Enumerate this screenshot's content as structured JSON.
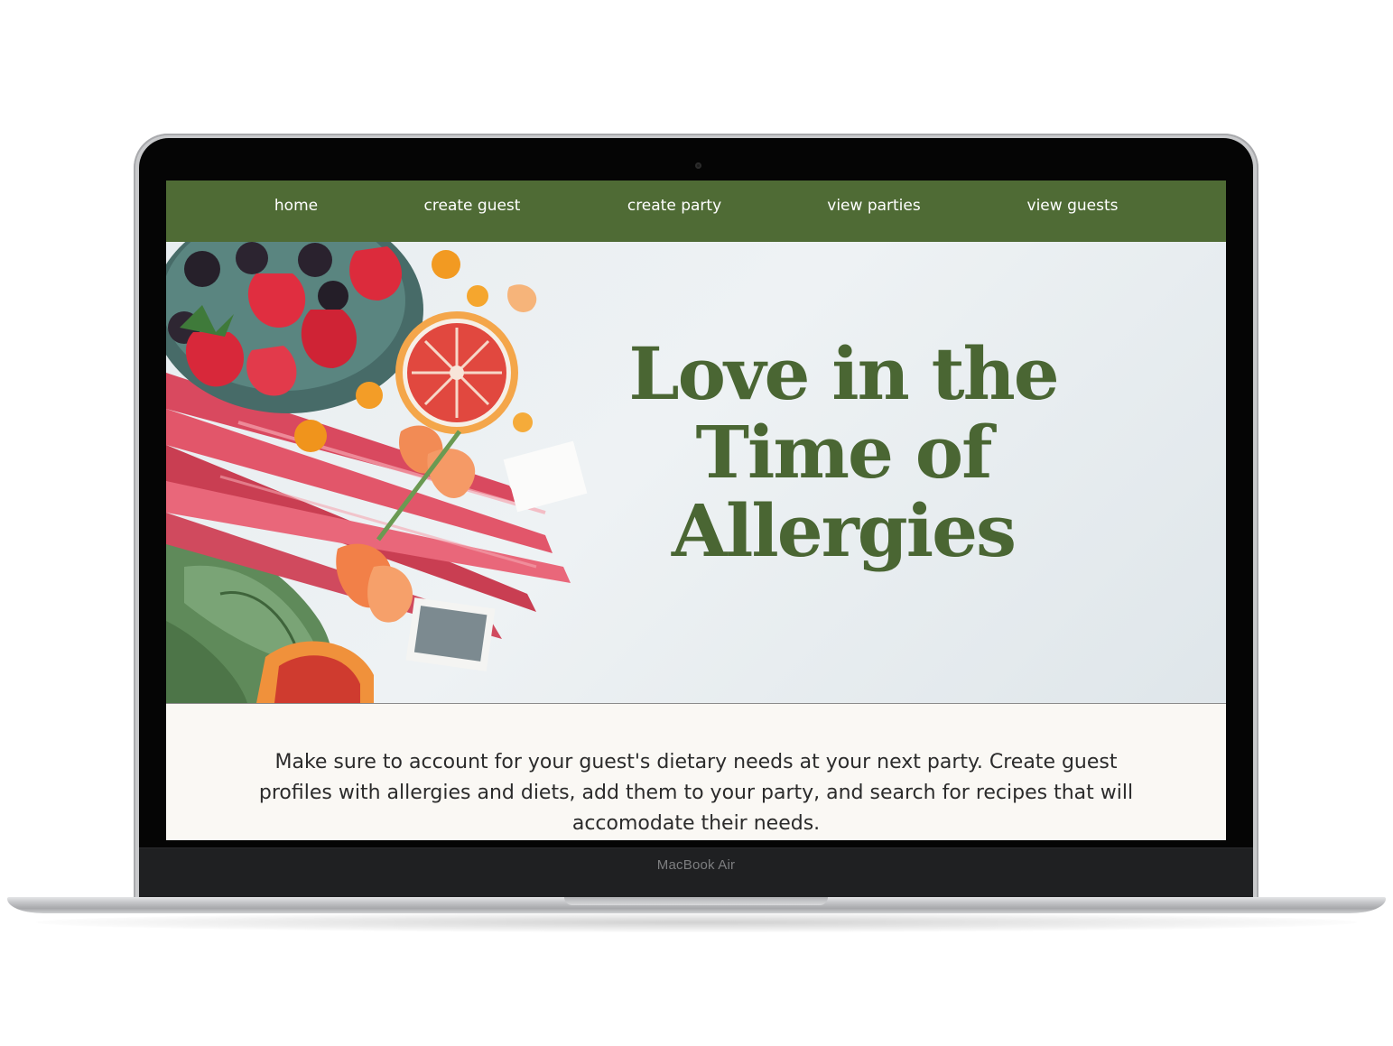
{
  "device": {
    "label": "MacBook Air"
  },
  "nav": {
    "items": [
      {
        "label": "home"
      },
      {
        "label": "create guest"
      },
      {
        "label": "create party"
      },
      {
        "label": "view parties"
      },
      {
        "label": "view guests"
      }
    ]
  },
  "hero": {
    "title_line1": "Love in the",
    "title_line2": "Time of",
    "title_line3": "Allergies",
    "image_icon": "fruit-flatlay-image"
  },
  "intro": {
    "text": "Make sure to account for your guest's dietary needs at your next party. Create guest profiles with allergies and diets, add them to your party, and search for recipes that will accomodate their needs."
  },
  "colors": {
    "nav_bg": "#4f6b35",
    "title": "#4a6633",
    "body_bg": "#faf8f4"
  }
}
